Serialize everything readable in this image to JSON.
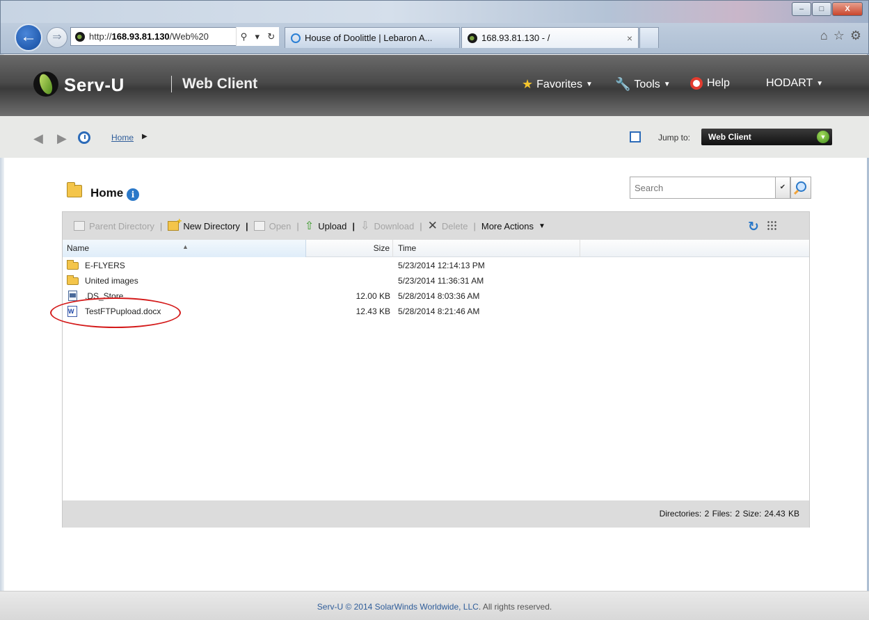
{
  "browser": {
    "window_buttons": [
      "–",
      "□",
      "X"
    ],
    "url_prefix": "http://",
    "url_host": "168.93.81.130",
    "url_rest": "/Web%20",
    "tabs": [
      {
        "label": "House of Doolittle | Lebaron A..."
      },
      {
        "label": "168.93.81.130 - /",
        "close": "×"
      }
    ]
  },
  "app": {
    "logo_text": "Serv-U",
    "logo_sub": "Web Client",
    "menu": {
      "favorites": "Favorites",
      "tools": "Tools",
      "help": "Help",
      "user": "HODART"
    }
  },
  "navbar": {
    "breadcrumb": "Home",
    "jump_label": "Jump to:",
    "jump_value": "Web Client"
  },
  "content": {
    "folder_title": "Home",
    "search_placeholder": "Search",
    "toolbar": {
      "parent_directory": "Parent Directory",
      "new_directory": "New Directory",
      "open": "Open",
      "upload": "Upload",
      "download": "Download",
      "delete": "Delete",
      "more_actions": "More Actions"
    },
    "columns": {
      "name": "Name",
      "size": "Size",
      "time": "Time"
    },
    "files": [
      {
        "name": "E-FLYERS",
        "size": "",
        "time": "5/23/2014 12:14:13 PM",
        "icon": "folder-icon"
      },
      {
        "name": "United images",
        "size": "",
        "time": "5/23/2014 11:36:31 AM",
        "icon": "folder-icon"
      },
      {
        "name": ".DS_Store",
        "size": "12.00 KB",
        "time": "5/28/2014 8:03:36 AM",
        "icon": "file-icon"
      },
      {
        "name": "TestFTPupload.docx",
        "size": "12.43 KB",
        "time": "5/28/2014 8:21:46 AM",
        "icon": "word-doc-icon"
      }
    ],
    "status": "Directories: 2   Files: 2   Size: 24.43 KB"
  },
  "footer": {
    "prefix": "Serv-U © 2014 ",
    "company": "SolarWinds Worldwide, LLC",
    "suffix": ". All rights reserved."
  },
  "colors": {
    "accent": "#2a78c8",
    "highlight": "#d41a1a",
    "header_bg": "#4a4a4a"
  }
}
